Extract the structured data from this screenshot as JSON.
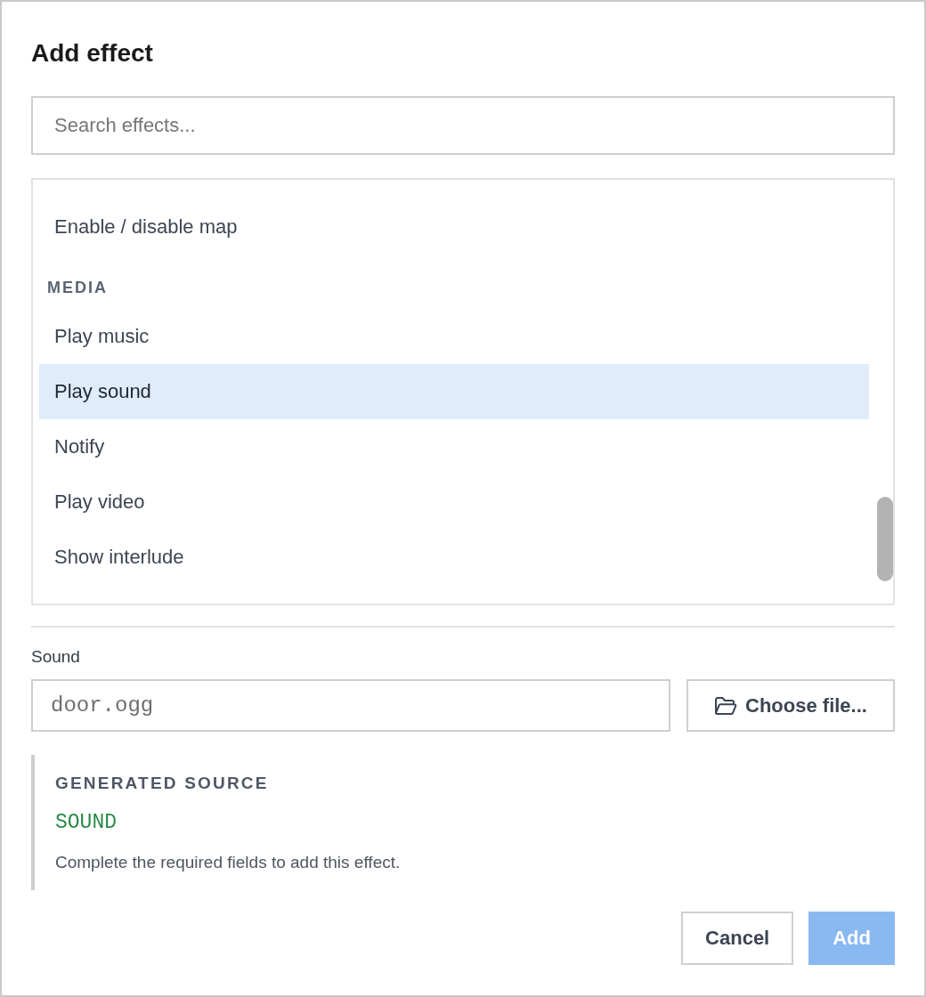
{
  "dialog": {
    "title": "Add effect"
  },
  "search": {
    "placeholder": "Search effects..."
  },
  "effect_list": {
    "groups": [
      {
        "items": [
          {
            "label": "Enable / disable map",
            "selected": false
          }
        ]
      },
      {
        "heading": "MEDIA",
        "items": [
          {
            "label": "Play music",
            "selected": false
          },
          {
            "label": "Play sound",
            "selected": true
          },
          {
            "label": "Notify",
            "selected": false
          },
          {
            "label": "Play video",
            "selected": false
          },
          {
            "label": "Show interlude",
            "selected": false
          }
        ]
      }
    ]
  },
  "sound_field": {
    "label": "Sound",
    "placeholder": "door.ogg",
    "browse_button": "Choose file..."
  },
  "generated_source": {
    "heading": "GENERATED SOURCE",
    "code": "SOUND",
    "message": "Complete the required fields to add this effect."
  },
  "buttons": [
    {
      "label": "Cancel",
      "kind": "secondary",
      "disabled": false
    },
    {
      "label": "Add",
      "kind": "primary",
      "disabled": true
    }
  ]
}
